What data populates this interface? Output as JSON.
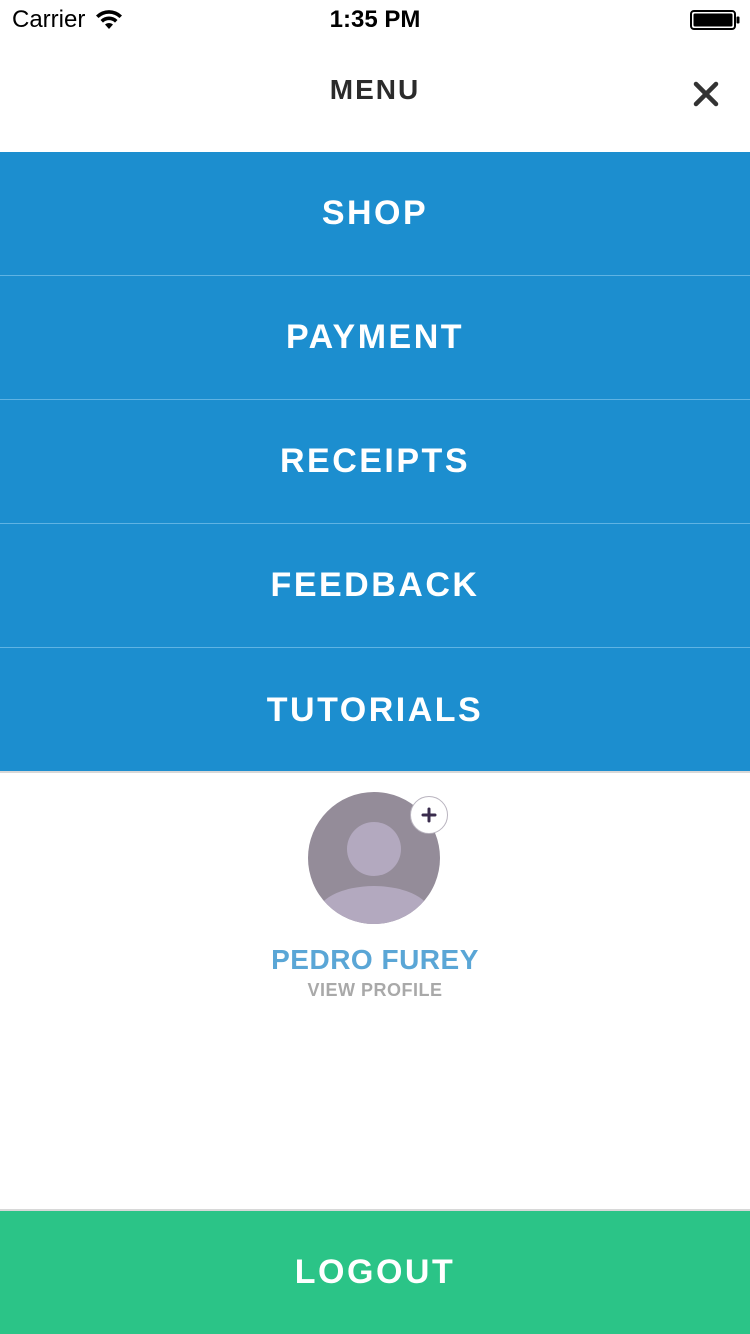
{
  "status_bar": {
    "carrier": "Carrier",
    "time": "1:35 PM",
    "wifi_icon": "wifi-icon",
    "battery_icon": "battery-full-icon"
  },
  "header": {
    "title": "MENU",
    "close_icon": "close-icon"
  },
  "menu": {
    "items": [
      {
        "label": "SHOP"
      },
      {
        "label": "PAYMENT"
      },
      {
        "label": "RECEIPTS"
      },
      {
        "label": "FEEDBACK"
      },
      {
        "label": "TUTORIALS"
      }
    ]
  },
  "profile": {
    "avatar_icon": "user-avatar-placeholder-icon",
    "add_photo_icon": "plus-icon",
    "name": "PEDRO FUREY",
    "view_profile_label": "VIEW PROFILE"
  },
  "logout": {
    "label": "LOGOUT"
  },
  "colors": {
    "menu_background": "#1c8ecf",
    "logout_background": "#2bc487",
    "profile_name": "#5aa6d6",
    "avatar_background": "#948c99"
  }
}
